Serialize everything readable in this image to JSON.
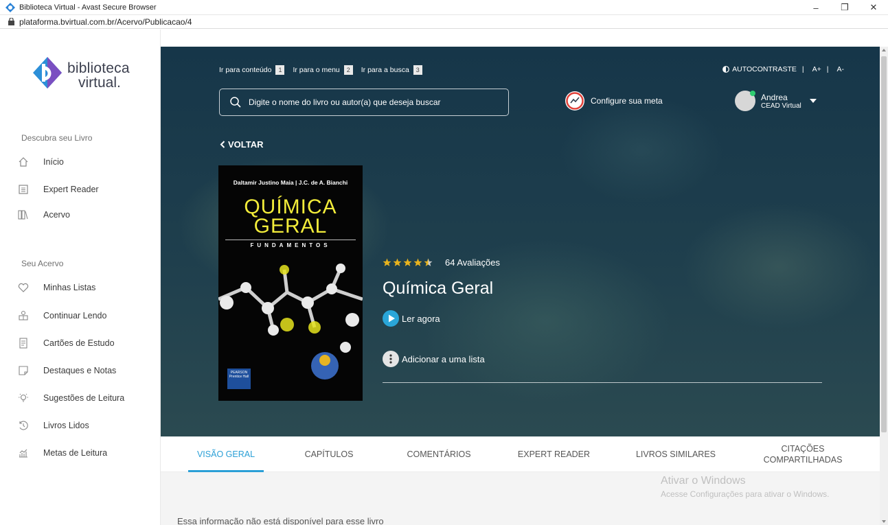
{
  "window": {
    "title": "Biblioteca Virtual - Avast Secure Browser",
    "minimize": "–",
    "restore": "❐",
    "close": "✕"
  },
  "address": {
    "url": "plataforma.bvirtual.com.br/Acervo/Publicacao/4"
  },
  "logo": {
    "line1": "biblioteca",
    "line2": "virtual."
  },
  "sidebar": {
    "section1_title": "Descubra seu Livro",
    "section1_items": [
      {
        "label": "Início",
        "icon": "home-icon"
      },
      {
        "label": "Expert Reader",
        "icon": "document-icon"
      },
      {
        "label": "Acervo",
        "icon": "books-icon"
      }
    ],
    "section2_title": "Seu Acervo",
    "section2_items": [
      {
        "label": "Minhas Listas",
        "icon": "heart-icon"
      },
      {
        "label": "Continuar Lendo",
        "icon": "bookmark-person-icon"
      },
      {
        "label": "Cartões de Estudo",
        "icon": "flashcard-icon"
      },
      {
        "label": "Destaques e Notas",
        "icon": "note-icon"
      },
      {
        "label": "Sugestões de Leitura",
        "icon": "lightbulb-icon"
      },
      {
        "label": "Livros Lidos",
        "icon": "history-icon"
      },
      {
        "label": "Metas de Leitura",
        "icon": "goal-chart-icon"
      }
    ]
  },
  "header": {
    "skip_links": [
      {
        "label": "Ir para conteúdo",
        "key": "1"
      },
      {
        "label": "Ir para o menu",
        "key": "2"
      },
      {
        "label": "Ir para a busca",
        "key": "3"
      }
    ],
    "autocontrast": "AUTOCONTRASTE",
    "font_increase": "A+",
    "font_decrease": "A-",
    "search_placeholder": "Digite o nome do livro ou autor(a) que deseja buscar",
    "meta_label": "Configure sua meta",
    "user_name": "Andrea",
    "user_org": "CEAD Virtual"
  },
  "book": {
    "back_label": "VOLTAR",
    "cover_authors": "Daltamir Justino Maia | J.C. de A. Bianchi",
    "cover_title_line1": "QUÍMICA",
    "cover_title_line2": "GERAL",
    "cover_subtitle": "FUNDAMENTOS",
    "cover_publisher": "PEARSON Prentice Hall",
    "rating_stars": 4.5,
    "rating_count": "64 Avaliações",
    "title": "Química Geral",
    "read_now": "Ler agora",
    "add_to_list": "Adicionar a uma lista"
  },
  "tabs": [
    {
      "label": "VISÃO GERAL",
      "active": true
    },
    {
      "label": "CAPÍTULOS",
      "active": false
    },
    {
      "label": "COMENTÁRIOS",
      "active": false
    },
    {
      "label": "EXPERT READER",
      "active": false
    },
    {
      "label": "LIVROS SIMILARES",
      "active": false
    },
    {
      "label": "CITAÇÕES COMPARTILHADAS",
      "active": false
    }
  ],
  "content": {
    "info": "Essa informação não está disponível para esse livro"
  },
  "watermark": {
    "line1": "Ativar o Windows",
    "line2": "Acesse Configurações para ativar o Windows."
  },
  "colors": {
    "accent": "#2a9fd6",
    "hero_dark": "#163649",
    "star": "#e8b31e",
    "cover_title": "#f2ec3a"
  }
}
